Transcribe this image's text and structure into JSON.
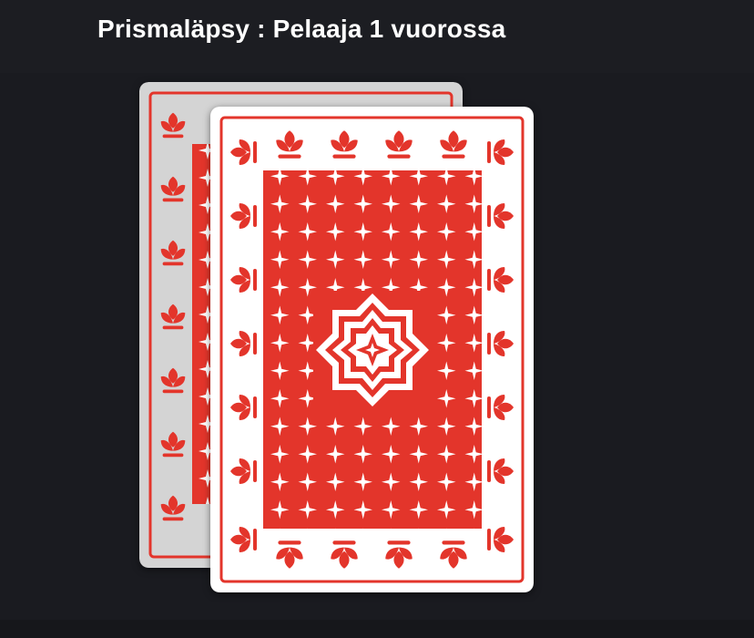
{
  "header": {
    "title": "Prismaläpsy : Pelaaja 1 vuorossa"
  },
  "game": {
    "pile": [
      {
        "face": "down",
        "icon": "card-back-icon"
      },
      {
        "face": "down",
        "icon": "card-back-icon"
      }
    ]
  },
  "colors": {
    "background": "#1c1d22",
    "card_red": "#e3352b",
    "card_white": "#ffffff",
    "card_dim": "#d4d4d4",
    "title_text": "#ffffff"
  }
}
